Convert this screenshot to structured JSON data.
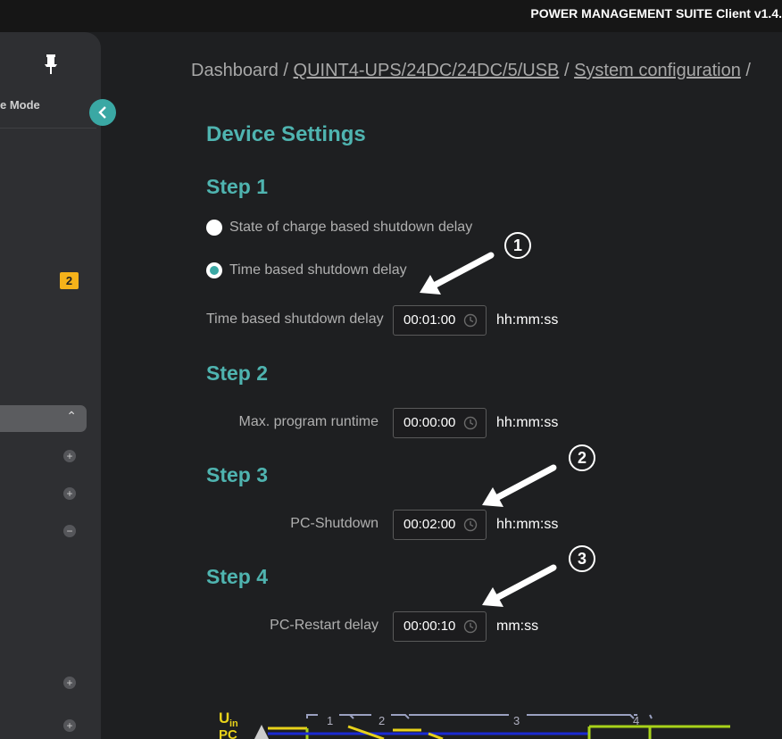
{
  "app": {
    "title": "POWER MANAGEMENT SUITE Client   v1.4."
  },
  "sidebar": {
    "mode_label": "e Mode",
    "badge": "2",
    "expander_icon": "chevron-up-icon",
    "round_buttons": [
      "+",
      "+",
      "−",
      "+",
      "+"
    ]
  },
  "breadcrumb": {
    "root": "Dashboard",
    "sep1": "/",
    "device": "QUINT4-UPS/24DC/24DC/5/USB",
    "sep2": "/",
    "page": "System configuration",
    "sep3": "/"
  },
  "settings": {
    "title": "Device Settings",
    "step1": {
      "title": "Step 1",
      "radio_soc": "State of charge based shutdown delay",
      "radio_time": "Time based shutdown delay",
      "selected": "time",
      "field_label": "Time based shutdown delay",
      "value": "00:01:00",
      "unit": "hh:mm:ss"
    },
    "step2": {
      "title": "Step 2",
      "field_label": "Max. program runtime",
      "value": "00:00:00",
      "unit": "hh:mm:ss"
    },
    "step3": {
      "title": "Step 3",
      "field_label": "PC-Shutdown",
      "value": "00:02:00",
      "unit": "hh:mm:ss"
    },
    "step4": {
      "title": "Step 4",
      "field_label": "PC-Restart delay",
      "value": "00:00:10",
      "unit": "mm:ss"
    }
  },
  "annotations": {
    "one": "1",
    "two": "2",
    "three": "3"
  },
  "diagram": {
    "uin_label": "U",
    "uin_sub": "in",
    "pc_label": "PC",
    "markers": [
      "1",
      "2",
      "3",
      "4"
    ]
  },
  "colors": {
    "accent": "#3aa8a4",
    "badge": "#f5b21a",
    "yellow": "#e8d21a",
    "lime": "#a8d21a",
    "blue": "#1a2ad2"
  }
}
